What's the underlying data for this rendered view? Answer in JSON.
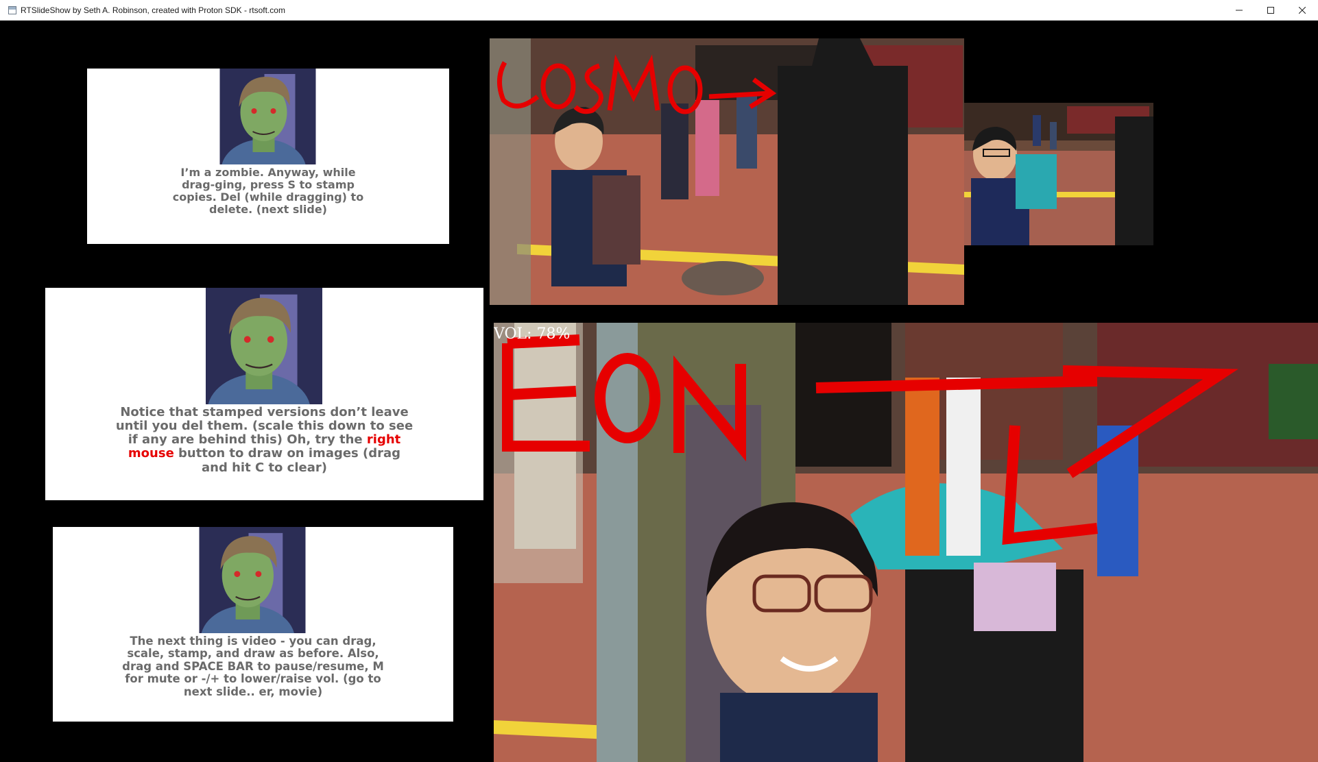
{
  "window": {
    "title": "RTSlideShow by Seth A. Robinson, created with Proton SDK - rtsoft.com",
    "buttons": {
      "minimize": "minimize",
      "maximize": "maximize",
      "close": "close"
    }
  },
  "slides": [
    {
      "text": "I’m a zombie.  Anyway, while drag-ging, press S to stamp copies.  Del (while dragging) to delete. (next slide)"
    },
    {
      "text_before": "Notice that stamped versions don’t leave until you del them. (scale this down to see if any are behind this)  Oh, try the ",
      "highlight": "right mouse",
      "text_after": " button to draw on images   (drag and hit C to clear)"
    },
    {
      "text": "The next thing is video - you can drag, scale, stamp, and draw as before.  Also, drag and SPACE BAR to pause/resume, M for mute or -/+ to lower/raise vol.  (go to next slide.. er, movie)"
    }
  ],
  "photos": {
    "top_annotation": "COSMO →",
    "video_annotation": "EON"
  },
  "video": {
    "volume_label": "VOL: 78%"
  },
  "colors": {
    "annotation": "#e60000",
    "slide_text": "#6a6a6a",
    "highlight": "#e60000"
  }
}
